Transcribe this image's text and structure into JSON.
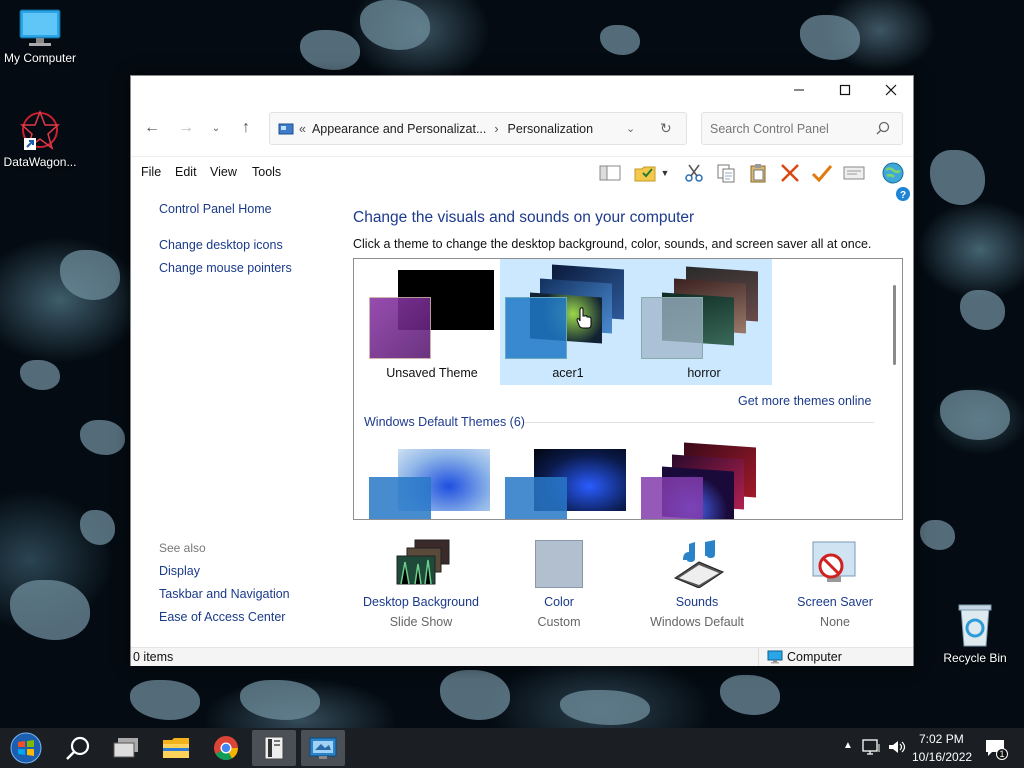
{
  "desktop": {
    "icons": [
      {
        "label": "My Computer",
        "icon": "monitor-icon"
      },
      {
        "label": "DataWagon...",
        "icon": "datawagon-icon"
      },
      {
        "label": "Recycle Bin",
        "icon": "recycle-bin-icon"
      }
    ]
  },
  "window": {
    "breadcrumb": {
      "prefix": "«",
      "parent": "Appearance and Personalizat...",
      "separator": "›",
      "current": "Personalization"
    },
    "search_placeholder": "Search Control Panel",
    "menu": [
      "File",
      "Edit",
      "View",
      "Tools"
    ],
    "left_links": [
      "Control Panel Home",
      "Change desktop icons",
      "Change mouse pointers"
    ],
    "see_also": {
      "title": "See also",
      "links": [
        "Display",
        "Taskbar and Navigation",
        "Ease of Access Center"
      ]
    },
    "heading": "Change the visuals and sounds on your computer",
    "subheading": "Click a theme to change the desktop background, color, sounds, and screen saver all at once.",
    "themes": {
      "my_themes": [
        {
          "label": "Unsaved Theme",
          "selected": false
        },
        {
          "label": "acer1",
          "selected": true
        },
        {
          "label": "horror",
          "selected": true
        }
      ],
      "get_more_link": "Get more themes online",
      "default_group_label": "Windows Default Themes (6)"
    },
    "bottom": [
      {
        "title": "Desktop Background",
        "sub": "Slide Show",
        "icon": "desktop-background-icon"
      },
      {
        "title": "Color",
        "sub": "Custom",
        "icon": "color-swatch-icon"
      },
      {
        "title": "Sounds",
        "sub": "Windows Default",
        "icon": "sounds-icon"
      },
      {
        "title": "Screen Saver",
        "sub": "None",
        "icon": "screen-saver-icon"
      }
    ],
    "status": {
      "items": "0 items",
      "location": "Computer"
    }
  },
  "taskbar": {
    "apps": [
      "start-icon",
      "search-icon",
      "task-view-icon",
      "file-explorer-icon",
      "chrome-icon",
      "control-panel-icon",
      "personalization-icon"
    ],
    "time": "7:02 PM",
    "date": "10/16/2022",
    "notification_count": "1"
  },
  "colors": {
    "link": "#1a3a8a",
    "heading": "#1d3a8e",
    "selection": "#cce8ff",
    "taskbar": "#1b1e22"
  }
}
